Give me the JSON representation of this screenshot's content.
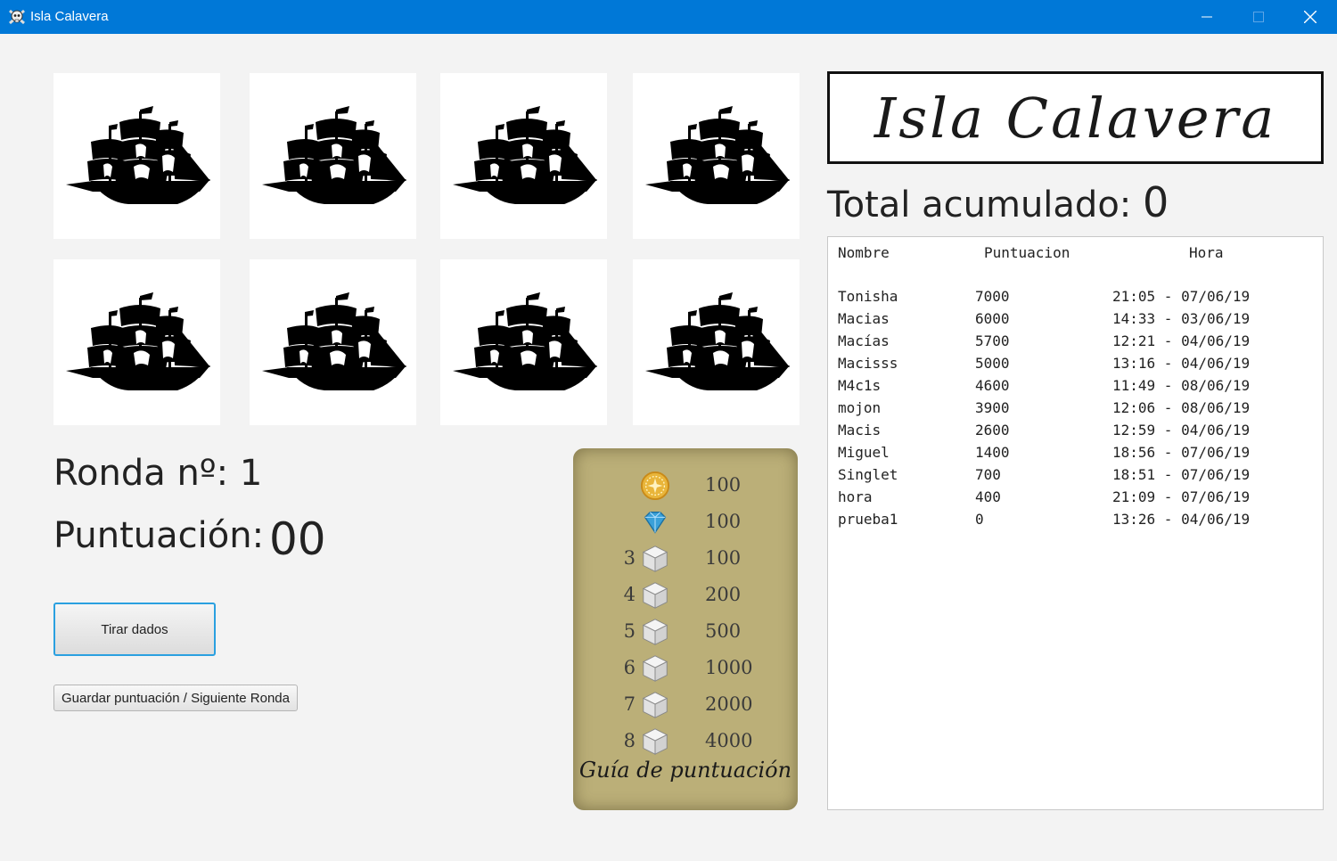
{
  "window": {
    "title": "Isla Calavera",
    "accent_color": "#0078d7"
  },
  "dice": [
    {
      "face": "ship-icon"
    },
    {
      "face": "ship-icon"
    },
    {
      "face": "ship-icon"
    },
    {
      "face": "ship-icon"
    },
    {
      "face": "ship-icon"
    },
    {
      "face": "ship-icon"
    },
    {
      "face": "ship-icon"
    },
    {
      "face": "ship-icon"
    }
  ],
  "game": {
    "ronda_label": "Ronda nº: 1",
    "puntuacion_label": "Puntuación:",
    "puntuacion_value": "00",
    "roll_button": "Tirar dados",
    "save_button": "Guardar puntuación / Siguiente Ronda"
  },
  "guide": {
    "title": "Guía de puntuación",
    "rows": [
      {
        "count": "",
        "icon": "gold-coin-icon",
        "points": "100"
      },
      {
        "count": "",
        "icon": "diamond-icon",
        "points": "100"
      },
      {
        "count": "3",
        "icon": "die-icon",
        "points": "100"
      },
      {
        "count": "4",
        "icon": "die-icon",
        "points": "200"
      },
      {
        "count": "5",
        "icon": "die-icon",
        "points": "500"
      },
      {
        "count": "6",
        "icon": "die-icon",
        "points": "1000"
      },
      {
        "count": "7",
        "icon": "die-icon",
        "points": "2000"
      },
      {
        "count": "8",
        "icon": "die-icon",
        "points": "4000"
      }
    ]
  },
  "header": {
    "logo_text": "Isla Calavera",
    "total_label": "Total acumulado:",
    "total_value": "0"
  },
  "scores": {
    "columns": [
      "Nombre",
      "Puntuacion",
      "Hora"
    ],
    "rows": [
      {
        "name": "Tonisha",
        "points": "7000",
        "time": "21:05 - 07/06/19"
      },
      {
        "name": "Macias",
        "points": "6000",
        "time": "14:33 - 03/06/19"
      },
      {
        "name": "Macías",
        "points": "5700",
        "time": "12:21 - 04/06/19"
      },
      {
        "name": "Macisss",
        "points": "5000",
        "time": "13:16 - 04/06/19"
      },
      {
        "name": "M4c1s",
        "points": "4600",
        "time": "11:49 - 08/06/19"
      },
      {
        "name": "mojon",
        "points": "3900",
        "time": "12:06 - 08/06/19"
      },
      {
        "name": "Macis",
        "points": "2600",
        "time": "12:59 - 04/06/19"
      },
      {
        "name": "Miguel",
        "points": "1400",
        "time": "18:56 - 07/06/19"
      },
      {
        "name": "Singlet",
        "points": "700",
        "time": "18:51 - 07/06/19"
      },
      {
        "name": "hora",
        "points": "400",
        "time": "21:09 - 07/06/19"
      },
      {
        "name": "prueba1",
        "points": "0",
        "time": "13:26 - 04/06/19"
      }
    ]
  }
}
